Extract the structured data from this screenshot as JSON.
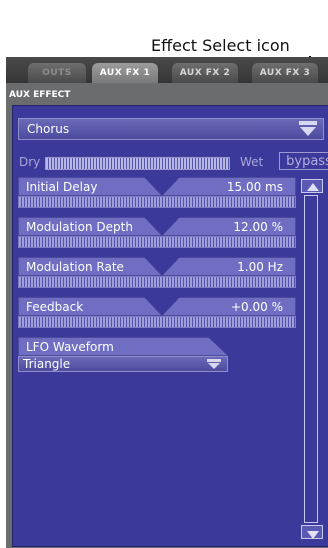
{
  "annotation": {
    "label": "Effect Select icon"
  },
  "tabs": [
    {
      "label": "OUTS",
      "active": false
    },
    {
      "label": "AUX FX 1",
      "active": true
    },
    {
      "label": "AUX FX 2",
      "active": false
    },
    {
      "label": "AUX FX 3",
      "active": false
    }
  ],
  "section_label": "AUX EFFECT",
  "effect_select": {
    "value": "Chorus",
    "icon": "chevron-down-icon"
  },
  "mix": {
    "dry_label": "Dry",
    "wet_label": "Wet",
    "bypass_label": "bypass"
  },
  "parameters": [
    {
      "name": "Initial Delay",
      "value": "15.00 ms"
    },
    {
      "name": "Modulation Depth",
      "value": "12.00 %"
    },
    {
      "name": "Modulation Rate",
      "value": "1.00 Hz"
    },
    {
      "name": "Feedback",
      "value": "+0.00 %"
    }
  ],
  "lfo": {
    "label": "LFO Waveform",
    "value": "Triangle"
  },
  "colors": {
    "panel_bg": "#3b3a9a",
    "param_header": "#6f6ec2",
    "tab_active": "#8a8a8a"
  }
}
